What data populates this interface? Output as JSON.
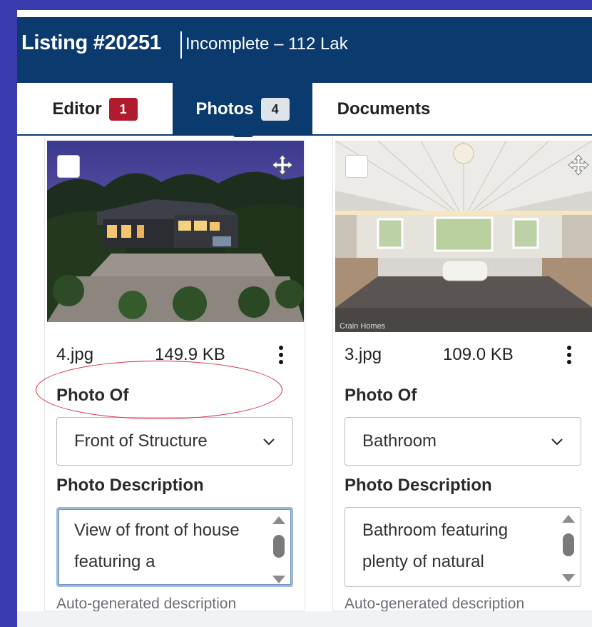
{
  "header": {
    "listing_title": "Listing #20251",
    "status": "Incomplete – 112 Lak"
  },
  "tabs": [
    {
      "label": "Editor",
      "badge": "1"
    },
    {
      "label": "Photos",
      "badge": "4"
    },
    {
      "label": "Documents"
    }
  ],
  "photos": [
    {
      "filename": "4.jpg",
      "size": "149.9 KB",
      "photo_of_label": "Photo Of",
      "photo_of_value": "Front of Structure",
      "description_label": "Photo Description",
      "description": "View of front of house featuring a",
      "hint": "Auto-generated description",
      "image_subject": "house-exterior-dusk"
    },
    {
      "filename": "3.jpg",
      "size": "109.0 KB",
      "photo_of_label": "Photo Of",
      "photo_of_value": "Bathroom",
      "description_label": "Photo Description",
      "description": "Bathroom featuring plenty of natural",
      "hint": "Auto-generated description",
      "watermark": "Crain Homes",
      "image_subject": "bathroom-interior"
    }
  ],
  "colors": {
    "header_bg": "#0a3a6e",
    "badge_red": "#b01c2e",
    "annotation_red": "#d7263d",
    "outer_bg": "#3b3bb0"
  }
}
